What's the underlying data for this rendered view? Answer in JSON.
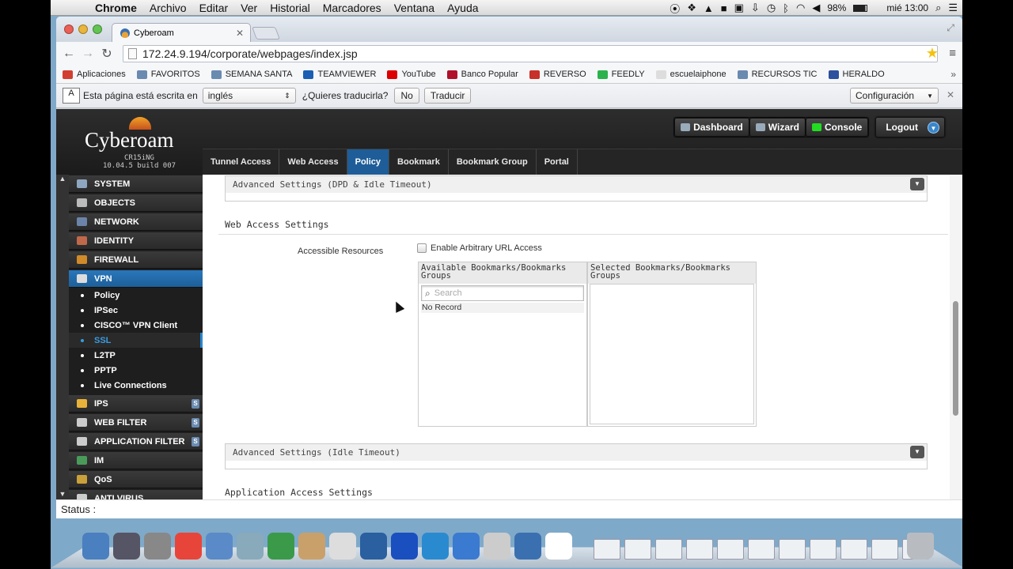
{
  "menubar": {
    "app": "Chrome",
    "items": [
      "Archivo",
      "Editar",
      "Ver",
      "Historial",
      "Marcadores",
      "Ventana",
      "Ayuda"
    ],
    "battery": "98%",
    "clock": "mié 13:00"
  },
  "browser": {
    "tab_title": "Cyberoam",
    "url": "172.24.9.194/corporate/webpages/index.jsp",
    "bookmarks": [
      {
        "label": "Aplicaciones",
        "color": "#d23f31"
      },
      {
        "label": "FAVORITOS",
        "color": "#6a8ab0"
      },
      {
        "label": "SEMANA SANTA",
        "color": "#6a8ab0"
      },
      {
        "label": "TEAMVIEWER",
        "color": "#1a5fb4"
      },
      {
        "label": "YouTube",
        "color": "#d00"
      },
      {
        "label": "Banco Popular",
        "color": "#b0102a"
      },
      {
        "label": "REVERSO",
        "color": "#c8302a"
      },
      {
        "label": "FEEDLY",
        "color": "#2bb24c"
      },
      {
        "label": "escuelaiphone",
        "color": "#ddd"
      },
      {
        "label": "RECURSOS TIC",
        "color": "#6a8ab0"
      },
      {
        "label": "HERALDO",
        "color": "#2c4f9e"
      }
    ],
    "translate_bar": {
      "text": "Esta página está escrita en",
      "language": "inglés",
      "question": "¿Quieres traducirla?",
      "no": "No",
      "translate": "Traducir",
      "config": "Configuración"
    },
    "status": "Status :"
  },
  "cyberoam": {
    "logo": "Cyberoam",
    "model": "CR15iNG",
    "version": "10.04.5 build 007",
    "header_buttons": {
      "dashboard": "Dashboard",
      "wizard": "Wizard",
      "console": "Console",
      "logout": "Logout"
    },
    "tabs": [
      "Tunnel Access",
      "Web Access",
      "Policy",
      "Bookmark",
      "Bookmark Group",
      "Portal"
    ],
    "active_tab": "Policy",
    "sidebar": {
      "sections": [
        "SYSTEM",
        "OBJECTS",
        "NETWORK",
        "IDENTITY",
        "FIREWALL",
        "VPN"
      ],
      "vpn_items": [
        "Policy",
        "IPSec",
        "CISCO™ VPN Client",
        "SSL",
        "L2TP",
        "PPTP",
        "Live Connections"
      ],
      "active_item": "SSL",
      "more_sections": [
        "IPS",
        "WEB FILTER",
        "APPLICATION FILTER",
        "IM",
        "QoS",
        "ANTI VIRUS"
      ]
    },
    "content": {
      "adv_dpd": "Advanced Settings (DPD & Idle Timeout)",
      "web_access_title": "Web Access Settings",
      "accessible_resources_label": "Accessible Resources",
      "enable_arbitrary": "Enable Arbitrary URL Access",
      "available_header": "Available Bookmarks/Bookmarks Groups",
      "selected_header": "Selected Bookmarks/Bookmarks Groups",
      "search_placeholder": "Search",
      "no_record": "No Record",
      "adv_idle": "Advanced Settings (Idle Timeout)",
      "app_access_title": "Application Access Settings"
    }
  }
}
